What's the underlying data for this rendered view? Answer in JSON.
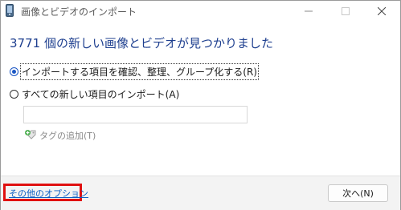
{
  "window": {
    "title": "画像とビデオのインポート"
  },
  "main": {
    "heading": "3771 個の新しい画像とビデオが見つかりました",
    "options": [
      {
        "label": "インポートする項目を確認、整理、グループ化する(R)",
        "checked": true
      },
      {
        "label": "すべての新しい項目のインポート(A)",
        "checked": false
      }
    ],
    "tag_input": {
      "value": "",
      "placeholder": ""
    },
    "add_tag_label": "タグの追加(T)"
  },
  "footer": {
    "more_options_link": "その他のオプション",
    "next_button": "次へ(N)"
  },
  "colors": {
    "heading": "#1e3f8f",
    "link": "#0b5fc4",
    "highlight_box": "#e01010",
    "radio_accent": "#1a56c4"
  },
  "icons": {
    "app": "camera-phone-icon",
    "add_tag": "tag-add-icon"
  }
}
